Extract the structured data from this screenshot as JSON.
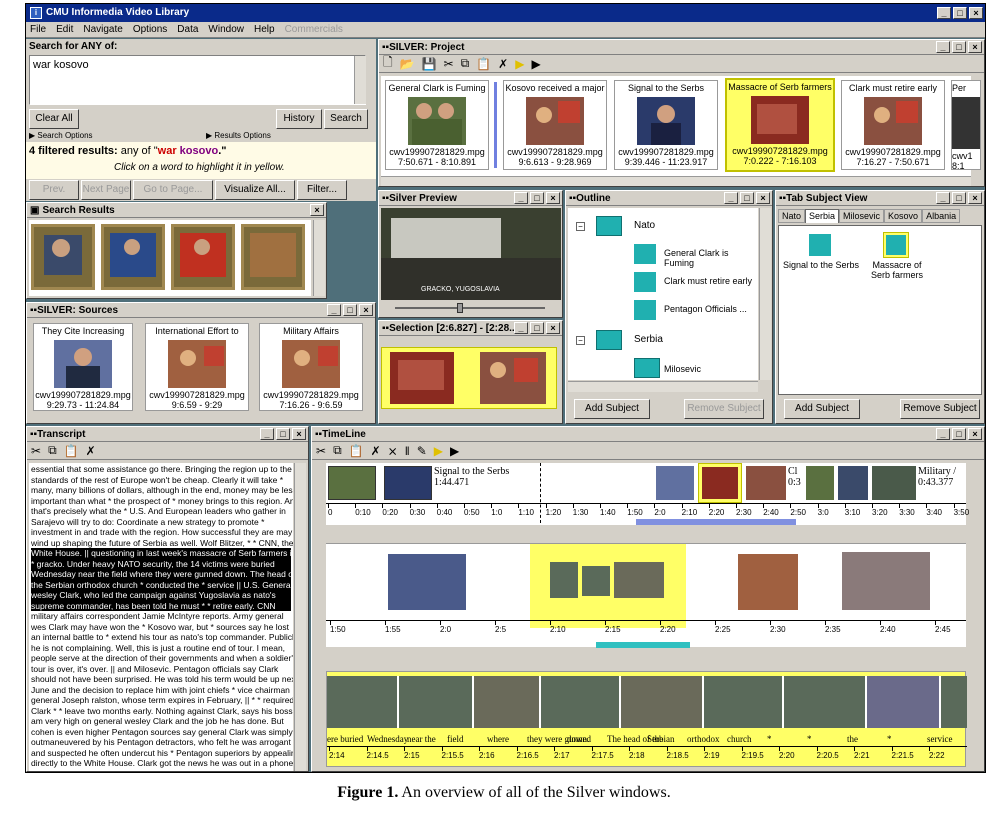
{
  "app": {
    "title": "CMU Informedia Video Library",
    "menu": [
      "File",
      "Edit",
      "Navigate",
      "Options",
      "Data",
      "Window",
      "Help",
      "Commercials"
    ]
  },
  "search": {
    "label": "Search for ANY of:",
    "query": "war kosovo",
    "clear": "Clear All",
    "history": "History",
    "search_btn": "Search",
    "search_options": "Search Options",
    "results_options": "Results Options",
    "filtered_title": "4 filtered results:",
    "any_of": "any of \"",
    "q1": "war",
    "q2": "kosovo",
    "q_end": ".\"",
    "hint": "Click on a word to highlight it in yellow.",
    "prev": "Prev. Page",
    "next": "Next Page",
    "goto": "Go to Page...",
    "visualize": "Visualize All...",
    "filter": "Filter..."
  },
  "results": {
    "title": "Search Results"
  },
  "project": {
    "title": "SILVER: Project",
    "cards": [
      {
        "title": "General Clark is Fuming",
        "file": "cwv199907281829.mpg",
        "time": "7:50.671 - 8:10.891"
      },
      {
        "title": "Kosovo received a major",
        "file": "cwv199907281829.mpg",
        "time": "9:6.613 - 9:28.969"
      },
      {
        "title": "Signal to the Serbs",
        "file": "cwv199907281829.mpg",
        "time": "9:39.446 - 11:23.917"
      },
      {
        "title": "Massacre of Serb farmers",
        "file": "cwv199907281829.mpg",
        "time": "7:0.222 - 7:16.103"
      },
      {
        "title": "Clark must retire early",
        "file": "cwv199907281829.mpg",
        "time": "7:16.27 - 7:50.671"
      },
      {
        "title": "Per",
        "file": "cwv1",
        "time": "8:1"
      }
    ]
  },
  "sources": {
    "title": "SILVER: Sources",
    "cards": [
      {
        "title": "They Cite Increasing",
        "file": "cwv199907281829.mpg",
        "time": "9:29.73 - 11:24.84"
      },
      {
        "title": "International Effort to",
        "file": "cwv199907281829.mpg",
        "time": "9:6.59 - 9:29"
      },
      {
        "title": "Military Affairs",
        "file": "cwv199907281829.mpg",
        "time": "7:16.26 - 9:6.59"
      }
    ]
  },
  "preview": {
    "title": "Silver Preview",
    "overlay": "GRACKO, YUGOSLAVIA"
  },
  "selection": {
    "title": "Selection [2:6.827] - [2:28..."
  },
  "outline": {
    "title": "Outline",
    "n1": "Nato",
    "i1": "General Clark is Fuming",
    "i2": "Clark must retire early",
    "i3": "Pentagon Officials ...",
    "n2": "Serbia",
    "n3": "Milosevic",
    "add": "Add Subject",
    "remove": "Remove Subject"
  },
  "tabsubject": {
    "title": "Tab Subject View",
    "tabs": [
      "Nato",
      "Serbia",
      "Milosevic",
      "Kosovo",
      "Albania"
    ],
    "i1": "Signal to the Serbs",
    "i2": "Massacre of Serb farmers",
    "add": "Add Subject",
    "remove": "Remove Subject"
  },
  "transcript": {
    "title": "Transcript",
    "lines": [
      "essential that some assistance go there. Bringing the region up to the",
      "standards of the rest of Europe won't be cheap. Clearly it will take *",
      "many, many billions of dollars, although in the end, money may be less",
      "important than what * the prospect of * money brings to this region. And",
      "that's precisely what the * U.S. And European leaders who gather in",
      "Sarajevo will try to do: Coordinate a new strategy to promote *",
      "investment in and trade with the region. How successful they are may",
      "wind up shaping the future of Serbia as well. Wolf Blitzer, * * CNN, the",
      "White House. || questioning in last week's massacre of Serb farmers in *",
      "* gracko. Under heavy NATO security, the 14 victims were buried",
      "Wednesday near the field where they were gunned down. The head of",
      "the Serbian orthodox church * conducted the * service || U.S. General",
      "wesley Clark, who led the campaign against Yugoslavia as nato's",
      "supreme commander, has been told he must * * retire early. CNN",
      "military affairs correspondent Jamie McIntyre reports. Army general",
      "wes Clark may have won the * Kosovo war, but * sources say he lost",
      "an internal battle to * extend his tour as nato's top commander. Publicly,",
      "he is not complaining. Well, this is just a routine end of tour. I mean,",
      "people serve at the direction of their governments and when a soldier's",
      "tour is over, it's over. || and Milosevic. Pentagon officials say Clark",
      "should not have been surprised. He was told his term would be up next",
      "June and the decision to replace him with joint chiefs * vice chairman",
      "general Joseph ralston, whose term expires in February, || * * required",
      "Clark * * leave two months early. Nothing against Clark, says his boss. I",
      "am very high on general wesley Clark and the job he has done. But",
      "cohen is even higher Pentagon sources say general Clark was simply *",
      "outmaneuvered by his Pentagon detractors, who felt he was arrogant",
      "and suspected he often undercut his * Pentagon superiors by appealing",
      "directly to the White House. Clark got the news he was out in a phone"
    ]
  },
  "timeline": {
    "title": "TimeLine",
    "clip1": "Signal to the Serbs",
    "clip1t": "1:44.471",
    "clip2": "Cl",
    "clip2t": "0:3",
    "clip3": "Military /",
    "clip3t": "0:43.377",
    "ruler1": [
      "0",
      "0:10",
      "0:20",
      "0:30",
      "0:40",
      "0:50",
      "1:0",
      "1:10",
      "1:20",
      "1:30",
      "1:40",
      "1:50",
      "2:0",
      "2:10",
      "2:20",
      "2:30",
      "2:40",
      "2:50",
      "3:0",
      "3:10",
      "3:20",
      "3:30",
      "3:40",
      "3:50"
    ],
    "ruler2": [
      "1:50",
      "1:55",
      "2:0",
      "2:5",
      "2:10",
      "2:15",
      "2:20",
      "2:25",
      "2:30",
      "2:35",
      "2:40",
      "2:45"
    ],
    "words": [
      "ere buried",
      "Wednesday",
      "near the",
      "field",
      "where",
      "they were gunned",
      "down.",
      "The head of the",
      "Serbian",
      "orthodox",
      "church",
      "*",
      "*",
      "the",
      "*",
      "service"
    ],
    "ruler3": [
      "2:14",
      "2:14.5",
      "2:15",
      "2:15.5",
      "2:16",
      "2:16.5",
      "2:17",
      "2:17.5",
      "2:18",
      "2:18.5",
      "2:19",
      "2:19.5",
      "2:20",
      "2:20.5",
      "2:21",
      "2:21.5",
      "2:22"
    ]
  },
  "caption": {
    "bold": "Figure 1.",
    "rest": " An overview of all of the Silver windows."
  }
}
